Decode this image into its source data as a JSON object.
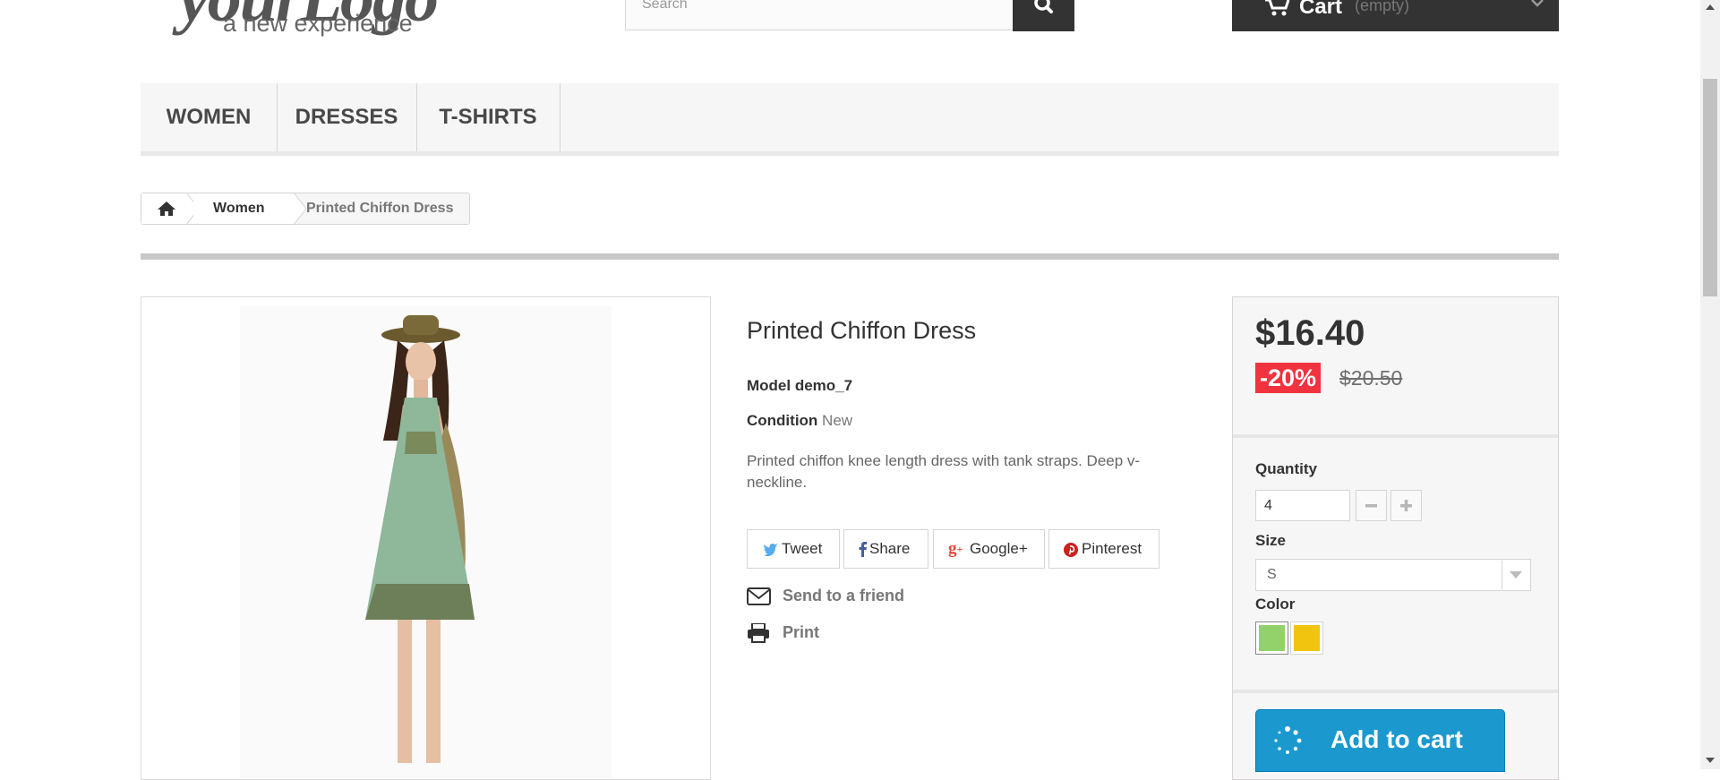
{
  "header": {
    "logo_top": "yourLogo",
    "logo_tagline": "a new experience",
    "search_placeholder": "Search",
    "cart_label": "Cart",
    "cart_status": "(empty)"
  },
  "menu": {
    "items": [
      "WOMEN",
      "DRESSES",
      "T-SHIRTS"
    ]
  },
  "breadcrumb": {
    "category": "Women",
    "current": "Printed Chiffon Dress"
  },
  "product": {
    "title": "Printed Chiffon Dress",
    "model_label": "Model",
    "model_value": "demo_7",
    "condition_label": "Condition",
    "condition_value": "New",
    "description": "Printed chiffon knee length dress with tank straps. Deep v-neckline.",
    "share_buttons": [
      "Tweet",
      "Share",
      "Google+",
      "Pinterest"
    ],
    "send_to_friend": "Send to a friend",
    "print": "Print"
  },
  "buy_box": {
    "price": "$16.40",
    "discount": "-20%",
    "old_price": "$20.50",
    "quantity_label": "Quantity",
    "quantity_value": "4",
    "size_label": "Size",
    "size_value": "S",
    "color_label": "Color",
    "colors": [
      "#93d26a",
      "#f1c40f"
    ],
    "add_to_cart": "Add to cart"
  },
  "colors": {
    "accent_blue": "#1b99cf",
    "discount_red": "#f13340",
    "header_dark": "#333333"
  }
}
